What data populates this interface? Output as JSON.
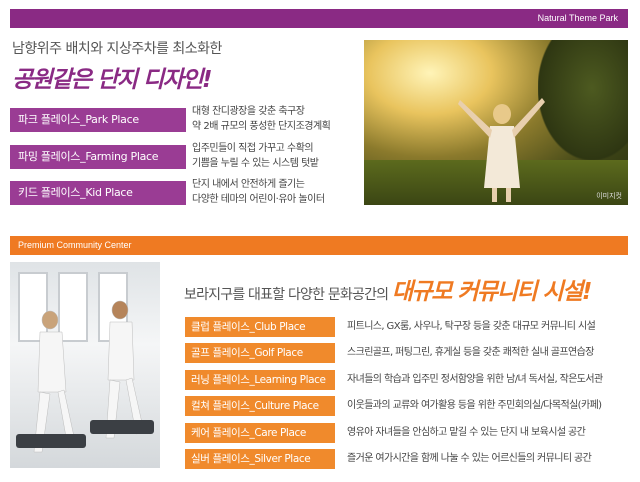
{
  "top_banner": {
    "label": "Natural Theme Park",
    "color": "#8a2a84"
  },
  "park_section": {
    "intro": "남향위주 배치와 지상주차를 최소화한",
    "headline": "공원같은 단지 디자인!",
    "places": [
      {
        "label": "파크 플레이스_Park Place",
        "desc_lines": [
          "대형 잔디광장을 갖춘 축구장",
          "약 2배 규모의 풍성한 단지조경계획"
        ]
      },
      {
        "label": "파밍 플레이스_Farming Place",
        "desc_lines": [
          "입주민들이 직접 가꾸고 수확의",
          "기쁨을 누릴 수 있는 시스템 텃밭"
        ]
      },
      {
        "label": "키드 플레이스_Kid Place",
        "desc_lines": [
          "단지 내에서 안전하게 즐기는",
          "다양한 테마의 어린이·유아 놀이터"
        ]
      }
    ],
    "photo_caption": "이미지컷"
  },
  "mid_banner": {
    "label": "Premium Community Center",
    "color": "#ef7a22"
  },
  "community_section": {
    "lead": "보라지구를 대표할 다양한 문화공간의 ",
    "headline": "대규모 커뮤니티 시설!",
    "places": [
      {
        "label": "클럽 플레이스_Club Place",
        "desc": "피트니스, GX룸, 사우나, 탁구장 등을 갖춘 대규모 커뮤니티 시설"
      },
      {
        "label": "골프 플레이스_Golf Place",
        "desc": "스크린골프, 퍼팅그린, 휴게실 등을 갖춘 쾌적한 실내 골프연습장"
      },
      {
        "label": "러닝 플레이스_Learning Place",
        "desc": "자녀들의 학습과 입주민 정서함양을 위한 남/녀 독서실, 작은도서관"
      },
      {
        "label": "컬쳐 플레이스_Culture Place",
        "desc": "이웃들과의 교류와 여가활용 등을 위한 주민회의실/다목적실(카페)"
      },
      {
        "label": "케어 플레이스_Care Place",
        "desc": "영유아 자녀들을 안심하고 맡길 수 있는 단지 내 보육시설 공간"
      },
      {
        "label": "실버 플레이스_Silver Place",
        "desc": "즐거운 여가시간을 함께 나눌 수 있는 어르신들의 커뮤니티 공간"
      }
    ]
  }
}
